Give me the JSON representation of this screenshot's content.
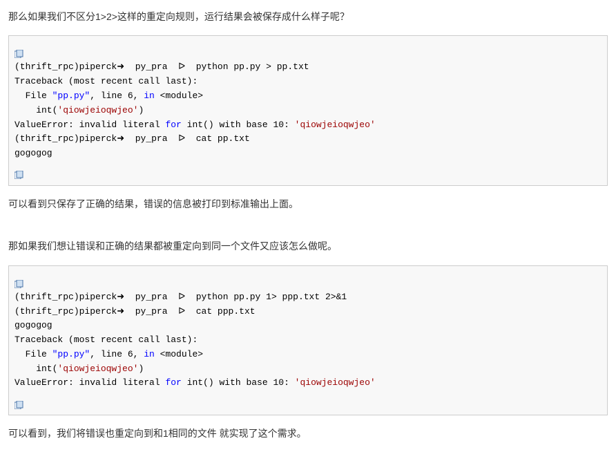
{
  "paragraphs": {
    "p1": "那么如果我们不区分1>2>这样的重定向规则，运行结果会被保存成什么样子呢？",
    "p2": "可以看到只保存了正确的结果，错误的信息被打印到标准输出上面。",
    "p3": "那如果我们想让错误和正确的结果都被重定向到同一个文件又应该怎么做呢。",
    "p4": "可以看到，我们将错误也重定向到和1相同的文件 就实现了这个需求。"
  },
  "code1": {
    "l1a": "(thrift_rpc)piperck➜  py_pra  ᐅ  python pp.py > pp.txt",
    "l2a": "Traceback (most recent call last):",
    "l3a": "  File ",
    "l3b": "\"pp.py\"",
    "l3c": ", line 6, ",
    "l3d": "in",
    "l3e": " <module>",
    "l4a": "    int(",
    "l4b": "'qiowjeioqwjeo'",
    "l4c": ")",
    "l5a": "ValueError: invalid literal ",
    "l5b": "for",
    "l5c": " int() with base 10: ",
    "l5d": "'qiowjeioqwjeo'",
    "l6a": "(thrift_rpc)piperck➜  py_pra  ᐅ  cat pp.txt",
    "l7a": "gogogog"
  },
  "code2": {
    "l1a": "(thrift_rpc)piperck➜  py_pra  ᐅ  python pp.py 1> ppp.txt 2>&1",
    "l2a": "(thrift_rpc)piperck➜  py_pra  ᐅ  cat ppp.txt",
    "l3a": "gogogog",
    "l4a": "Traceback (most recent call last):",
    "l5a": "  File ",
    "l5b": "\"pp.py\"",
    "l5c": ", line 6, ",
    "l5d": "in",
    "l5e": " <module>",
    "l6a": "    int(",
    "l6b": "'qiowjeioqwjeo'",
    "l6c": ")",
    "l7a": "ValueError: invalid literal ",
    "l7b": "for",
    "l7c": " int() with base 10: ",
    "l7d": "'qiowjeioqwjeo'"
  }
}
